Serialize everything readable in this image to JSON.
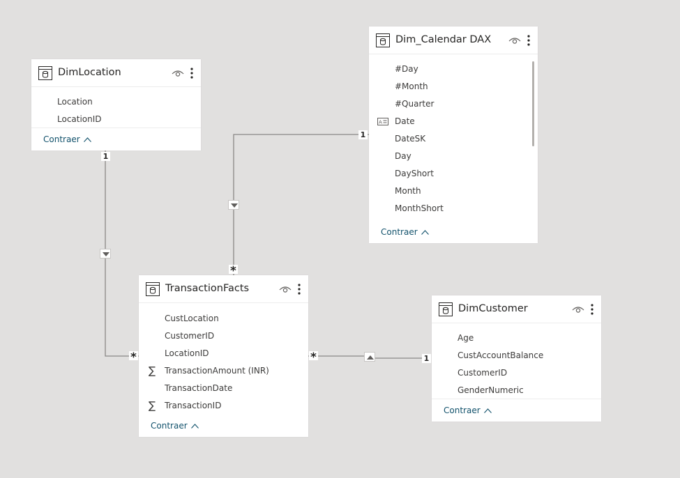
{
  "tables": {
    "dimlocation": {
      "title": "DimLocation",
      "fields": [
        "Location",
        "LocationID"
      ],
      "collapse_label": "Contraer"
    },
    "dim_calendar": {
      "title": "Dim_Calendar DAX",
      "fields": [
        "#Day",
        "#Month",
        "#Quarter",
        "Date",
        "DateSK",
        "Day",
        "DayShort",
        "Month",
        "MonthShort"
      ],
      "collapse_label": "Contraer"
    },
    "transactionfacts": {
      "title": "TransactionFacts",
      "fields": [
        "CustLocation",
        "CustomerID",
        "LocationID",
        "TransactionAmount (INR)",
        "TransactionDate",
        "TransactionID"
      ],
      "collapse_label": "Contraer"
    },
    "dimcustomer": {
      "title": "DimCustomer",
      "fields": [
        "Age",
        "CustAccountBalance",
        "CustomerID",
        "GenderNumeric"
      ],
      "collapse_label": "Contraer"
    }
  },
  "relationships": {
    "one": "1",
    "many": "*"
  },
  "icons": {
    "table": "table-icon",
    "visibility": "eye-icon",
    "more": "more-options-icon",
    "sum": "sigma-icon",
    "date": "date-field-icon",
    "collapse": "chevron-up-icon",
    "filter_direction": "triangle-icon"
  },
  "colors": {
    "canvas": "#e1e0df",
    "card": "#ffffff",
    "line": "#8a8886",
    "link": "#11516b",
    "text": "#252423"
  }
}
